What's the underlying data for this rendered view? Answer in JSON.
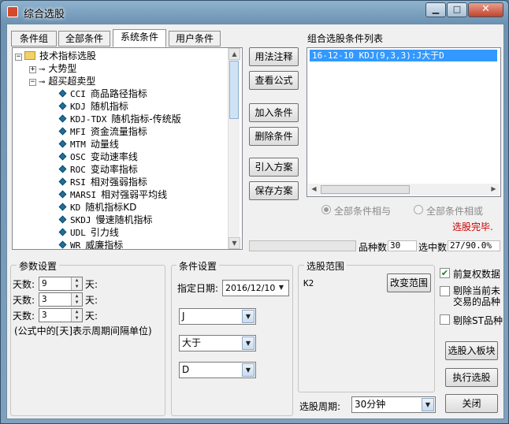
{
  "window": {
    "title": "综合选股"
  },
  "tabs": [
    "条件组",
    "全部条件",
    "系统条件",
    "用户条件"
  ],
  "tree": {
    "root": "技术指标选股",
    "group1": "大势型",
    "group2": "超买超卖型",
    "items": [
      {
        "code": "CCI",
        "name": "商品路径指标"
      },
      {
        "code": "KDJ",
        "name": "随机指标"
      },
      {
        "code": "KDJ-TDX",
        "name": "随机指标-传统版"
      },
      {
        "code": "MFI",
        "name": "资金流量指标"
      },
      {
        "code": "MTM",
        "name": "动量线"
      },
      {
        "code": "OSC",
        "name": "变动速率线"
      },
      {
        "code": "ROC",
        "name": "变动率指标"
      },
      {
        "code": "RSI",
        "name": "相对强弱指标"
      },
      {
        "code": "MARSI",
        "name": "相对强弱平均线"
      },
      {
        "code": "KD",
        "name": "随机指标KD"
      },
      {
        "code": "SKDJ",
        "name": "慢速随机指标"
      },
      {
        "code": "UDL",
        "name": "引力线"
      },
      {
        "code": "WR",
        "name": "威廉指标"
      }
    ]
  },
  "mid_buttons": {
    "usage": "用法注释",
    "formula": "查看公式",
    "add": "加入条件",
    "remove": "删除条件",
    "import": "引入方案",
    "save": "保存方案"
  },
  "cond_list": {
    "label": "组合选股条件列表",
    "items": [
      "16-12-10 KDJ(9,3,3):J大于D"
    ]
  },
  "logic": {
    "and_label": "全部条件相与",
    "or_label": "全部条件相或",
    "status": "选股完毕."
  },
  "stats": {
    "count_label": "品种数",
    "count_value": "30",
    "selected_label": "选中数",
    "selected_value": "27/90.0%"
  },
  "params": {
    "label": "参数设置",
    "rows": [
      {
        "label": "天数:",
        "value": "9",
        "unit": "天:"
      },
      {
        "label": "天数:",
        "value": "3",
        "unit": "天:"
      },
      {
        "label": "天数:",
        "value": "3",
        "unit": "天:"
      }
    ],
    "note": "(公式中的[天]表示周期间隔单位)"
  },
  "condition": {
    "label": "条件设置",
    "date_label": "指定日期:",
    "date_value": "2016/12/10",
    "line": "J",
    "op": "大于",
    "target": "D"
  },
  "range": {
    "label": "选股范围",
    "value": "K2",
    "change_button": "改变范围",
    "period_label": "选股周期:",
    "period_value": "30分钟"
  },
  "options": {
    "rights": "前复权数据",
    "exclude_new": "剔除当前未交易的品种",
    "exclude_st": "剔除ST品种"
  },
  "actions": {
    "to_block": "选股入板块",
    "execute": "执行选股",
    "close": "关闭"
  },
  "colors": {
    "selection": "#3399ff",
    "status": "#cc0000"
  }
}
